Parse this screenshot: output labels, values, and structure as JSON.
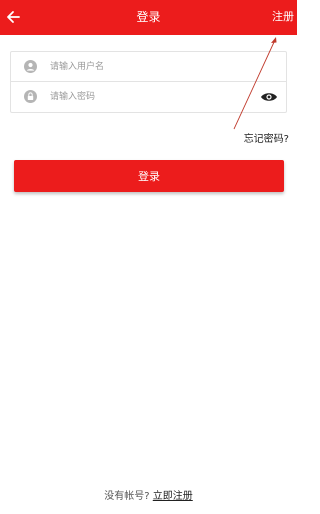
{
  "header": {
    "title": "登录",
    "register_label": "注册"
  },
  "form": {
    "username_placeholder": "请输入用户名",
    "password_placeholder": "请输入密码"
  },
  "forgot_password_label": "忘记密码?",
  "login_button_label": "登录",
  "footer": {
    "no_account_text": "没有帐号?",
    "register_link_label": "立即注册"
  },
  "colors": {
    "brand_red": "#ec1c1c",
    "annotation_arrow": "#c0392b"
  },
  "icons": {
    "back": "arrow-left-icon",
    "user": "user-icon",
    "lock": "lock-icon",
    "eye": "eye-icon"
  }
}
